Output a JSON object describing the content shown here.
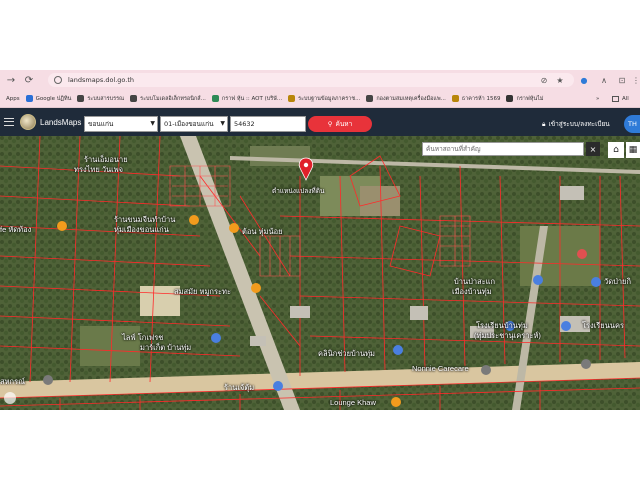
{
  "browser": {
    "url": "landsmaps.dol.go.th",
    "back_icon": "arrow-right-icon",
    "bookmarks": [
      {
        "label": "Apps",
        "color": "#555555"
      },
      {
        "label": "Google ปฏิทิน",
        "color": "#2a6fd6"
      },
      {
        "label": "ระบบสารบรรณ",
        "color": "#444444"
      },
      {
        "label": "ระบบโมเดลอิเล็กทรอนิกส์...",
        "color": "#444444"
      },
      {
        "label": "กราฟ หุ้น :: AOT (บริษั...",
        "color": "#2e8b57"
      },
      {
        "label": "ระบบฐานข้อมูลภาคราช...",
        "color": "#b8860b"
      },
      {
        "label": "กองตามสมเหตุเครื่องมือแพ...",
        "color": "#444444"
      },
      {
        "label": "ธาคารห้า 1569",
        "color": "#b8860b"
      },
      {
        "label": "กราฟหุ้นไม่",
        "color": "#333333"
      }
    ],
    "bookmarks_more": "»",
    "all_bookmarks": "All"
  },
  "app": {
    "name": "LandsMaps",
    "province": "ขอนแก่น",
    "district": "01-เมืองขอนแก่น",
    "parcel_no": "54632",
    "search_label": "ค้นหา",
    "login_label": "เข้าสู่ระบบ/ลงทะเบียน",
    "lang_label": "TH"
  },
  "map": {
    "place_search_placeholder": "ค้นหาสถานที่สำคัญ",
    "close_label": "×",
    "labels": [
      {
        "text": "ร้านเอ็มอนาย",
        "key": "a"
      },
      {
        "text": "ทรงไทย วันเพจ",
        "key": "b"
      },
      {
        "text": "ตำแหน่งแปลงที่ดิน",
        "key": "c"
      },
      {
        "text": "ร้านขนมจีนทำบ้าน",
        "key": "d"
      },
      {
        "text": "หุ่มเมืองขอนแก่น",
        "key": "e"
      },
      {
        "text": "fe หัดท้อง",
        "key": "f"
      },
      {
        "text": "ต้อน หุ่มน้อย",
        "key": "g"
      },
      {
        "text": "สมสมัย หมูกระทะ",
        "key": "h"
      },
      {
        "text": "ไลฟ์ โกเฟรช",
        "key": "i"
      },
      {
        "text": "มาร์เก็ต บ้านทุ่ม",
        "key": "j"
      },
      {
        "text": "บ้านป่าสะแก",
        "key": "k"
      },
      {
        "text": "เมืองบ้านทุ่ม",
        "key": "l"
      },
      {
        "text": "วัดป่ายกิ",
        "key": "m"
      },
      {
        "text": "โรงเรียนบ้านทุ่ม",
        "key": "n"
      },
      {
        "text": "(ทุ่มประชานุเคราะห์)",
        "key": "o"
      },
      {
        "text": "โรงเรียนนคร",
        "key": "p"
      },
      {
        "text": "Nonnie Carecare",
        "key": "q"
      },
      {
        "text": "คลินิกช่วยบ้านทุ่ม",
        "key": "r"
      },
      {
        "text": "ร้านเจ้ตุ้ม",
        "key": "s"
      },
      {
        "text": "Lounge Khaw",
        "key": "t"
      },
      {
        "text": "สหกรณ์",
        "key": "u"
      }
    ]
  },
  "colors": {
    "parcel_line": "#ff2a2a",
    "header_bg": "#1f2b3a",
    "search_btn": "#e8333a",
    "road": "#d9c6a0"
  }
}
